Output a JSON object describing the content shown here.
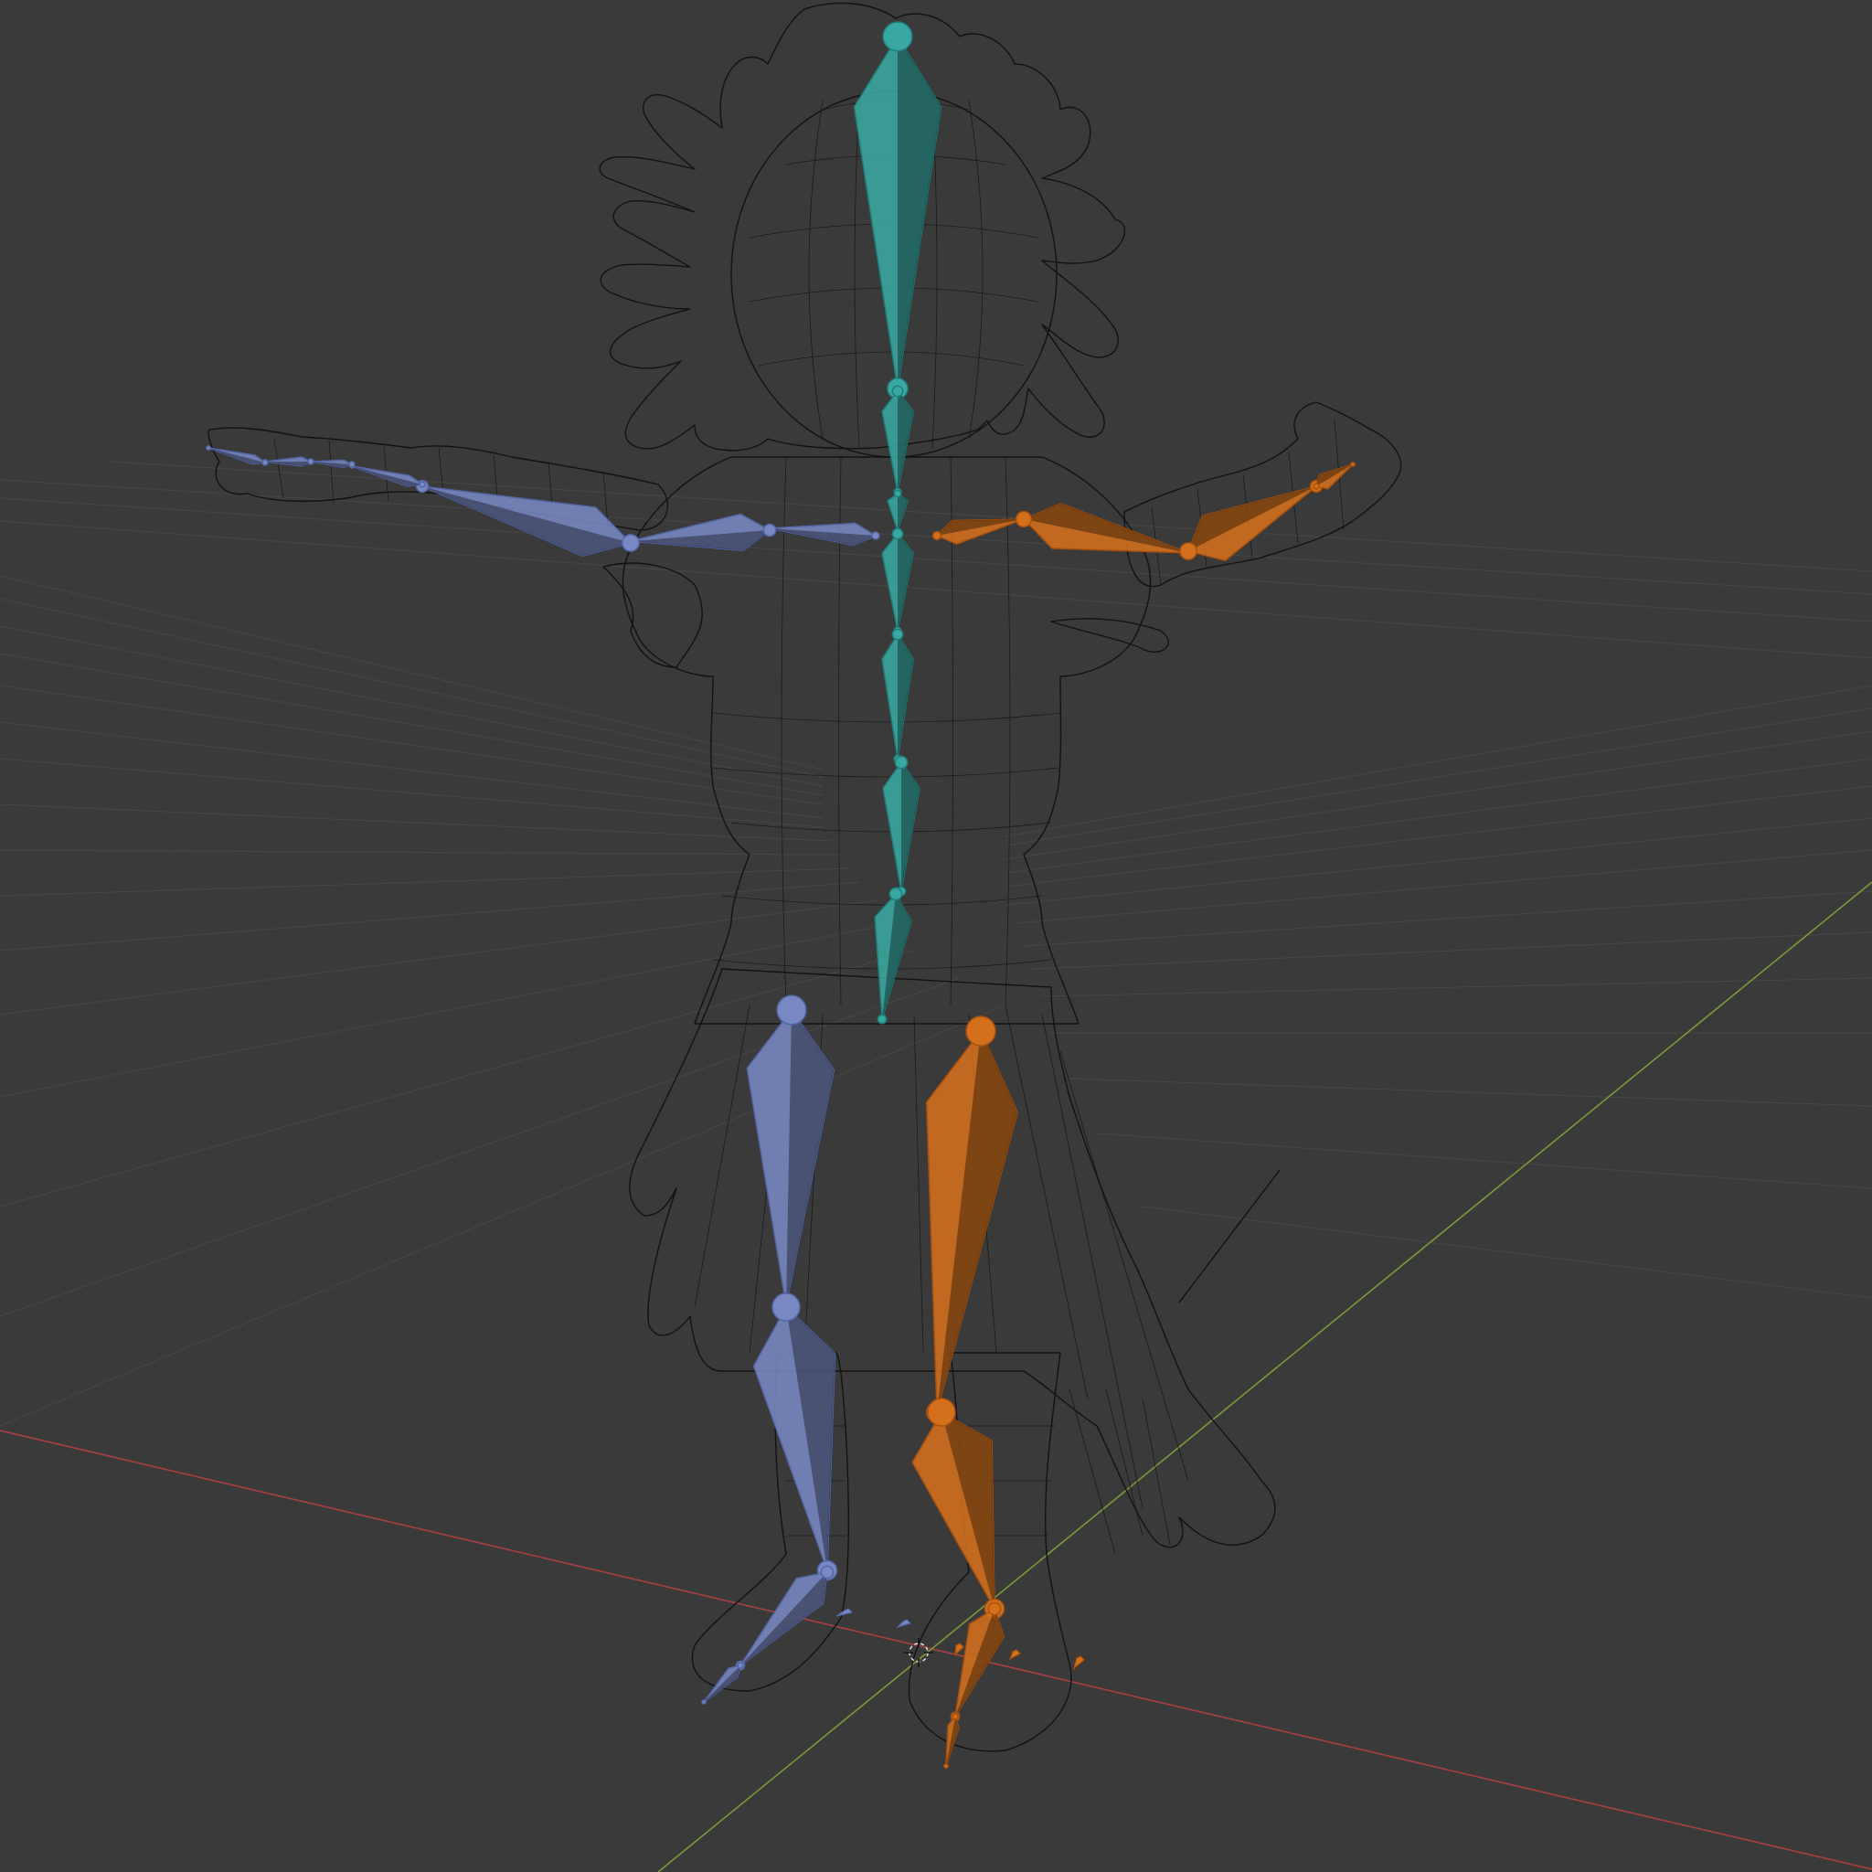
{
  "scene": {
    "background_color": "#3a3a3a",
    "grid_color": "#454545",
    "x_axis_color": "#a84040",
    "y_axis_color": "#7a9a3a",
    "wireframe_color": "#121212"
  },
  "armature": {
    "colors": {
      "spine": "#3aa8a2",
      "spine_edge": "#1f7f7a",
      "left": "#7888c2",
      "left_edge": "#5566a6",
      "right": "#d4701c",
      "right_edge": "#a8510e"
    },
    "bone_groups": [
      "spine",
      "left",
      "right"
    ]
  }
}
